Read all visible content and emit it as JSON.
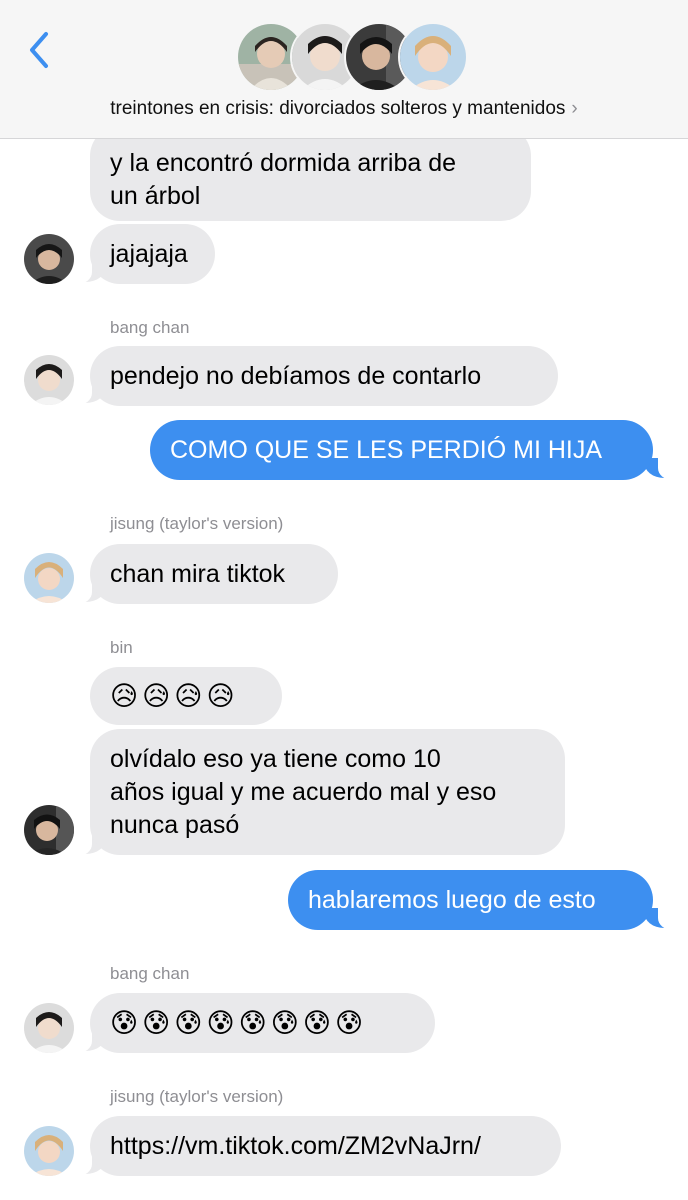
{
  "header": {
    "back_icon": "chevron-left-icon",
    "group_name": "treintones en crisis: divorciados solteros y mantenidos",
    "chevron": "›",
    "accent_color": "#3d8ff0"
  },
  "messages": [
    {
      "text": "y la encontró dormida arriba de\nun árbol"
    },
    {
      "text": "jajajaja"
    },
    {
      "sender": "bang chan",
      "text": "pendejo no debíamos de contarlo"
    },
    {
      "text": "COMO QUE SE LES PERDIÓ MI HIJA"
    },
    {
      "sender": "jisung (taylor's version)",
      "text": "chan mira tiktok"
    },
    {
      "sender": "bin",
      "text": "😥😥😥😥"
    },
    {
      "text": "olvídalo eso ya tiene como 10\naños igual y me acuerdo mal y eso\nnunca pasó"
    },
    {
      "text": "hablaremos luego de esto"
    },
    {
      "sender": "bang chan",
      "text": "😰😰😰😰😰😰😰😰"
    },
    {
      "sender": "jisung (taylor's version)",
      "text": "https://vm.tiktok.com/ZM2vNaJrn/"
    }
  ]
}
